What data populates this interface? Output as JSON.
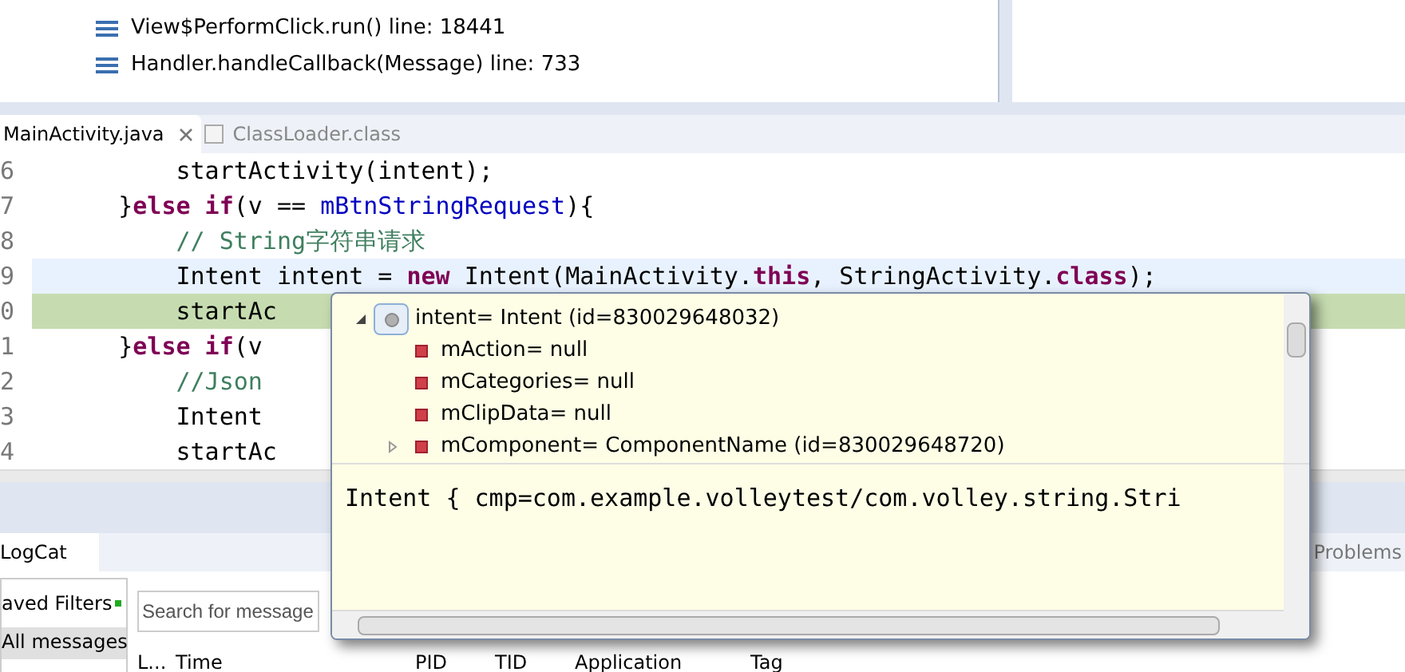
{
  "stack_frames": [
    {
      "label": "View$PerformClick.run() line: 18441"
    },
    {
      "label": "Handler.handleCallback(Message) line: 733"
    }
  ],
  "editor": {
    "tabs": [
      {
        "label": "MainActivity.java",
        "selected": true,
        "closable": true
      },
      {
        "label": "ClassLoader.class",
        "selected": false,
        "closable": false
      }
    ],
    "lines": [
      {
        "number": "6",
        "current": false,
        "suspended": false,
        "tokens": [
          {
            "kind": "plain",
            "text": "        startActivity(intent);"
          }
        ]
      },
      {
        "number": "7",
        "current": false,
        "suspended": false,
        "tokens": [
          {
            "kind": "plain",
            "text": "    }"
          },
          {
            "kind": "keyword",
            "text": "else if"
          },
          {
            "kind": "plain",
            "text": "(v == "
          },
          {
            "kind": "field",
            "text": "mBtnStringRequest"
          },
          {
            "kind": "plain",
            "text": "){"
          }
        ]
      },
      {
        "number": "8",
        "current": false,
        "suspended": false,
        "tokens": [
          {
            "kind": "comment",
            "text": "        // String字符串请求"
          }
        ]
      },
      {
        "number": "9",
        "current": true,
        "suspended": false,
        "tokens": [
          {
            "kind": "plain",
            "text": "        Intent intent = "
          },
          {
            "kind": "keyword",
            "text": "new"
          },
          {
            "kind": "plain",
            "text": " Intent(MainActivity."
          },
          {
            "kind": "keyword",
            "text": "this"
          },
          {
            "kind": "plain",
            "text": ", StringActivity."
          },
          {
            "kind": "keyword",
            "text": "class"
          },
          {
            "kind": "plain",
            "text": ");"
          }
        ]
      },
      {
        "number": "0",
        "current": false,
        "suspended": true,
        "tokens": [
          {
            "kind": "plain",
            "text": "        startAc"
          }
        ]
      },
      {
        "number": "1",
        "current": false,
        "suspended": false,
        "tokens": [
          {
            "kind": "plain",
            "text": "    }"
          },
          {
            "kind": "keyword",
            "text": "else if"
          },
          {
            "kind": "plain",
            "text": "(v"
          }
        ]
      },
      {
        "number": "2",
        "current": false,
        "suspended": false,
        "tokens": [
          {
            "kind": "comment",
            "text": "        //Json"
          }
        ]
      },
      {
        "number": "3",
        "current": false,
        "suspended": false,
        "tokens": [
          {
            "kind": "plain",
            "text": "        Intent"
          }
        ]
      },
      {
        "number": "4",
        "current": false,
        "suspended": false,
        "tokens": [
          {
            "kind": "plain",
            "text": "        startAc"
          }
        ]
      }
    ]
  },
  "inspector": {
    "tree": [
      {
        "label": "intent= Intent  (id=830029648032)",
        "kind": "local",
        "expanded": true,
        "children": [
          {
            "label": "mAction= null",
            "kind": "field"
          },
          {
            "label": "mCategories= null",
            "kind": "field"
          },
          {
            "label": "mClipData= null",
            "kind": "field"
          },
          {
            "label": "mComponent= ComponentName  (id=830029648720)",
            "kind": "field",
            "has_children": true
          }
        ]
      }
    ],
    "detail": "Intent { cmp=com.example.volleytest/com.volley.string.Stri"
  },
  "logcat": {
    "tab": "LogCat",
    "filters_title": "aved Filters",
    "filters": [
      {
        "label": "All messages",
        "selected": true
      }
    ],
    "search": {
      "placeholder": "Search for message"
    },
    "columns": [
      "L...",
      "Time",
      "PID",
      "TID",
      "Application",
      "Tag"
    ]
  },
  "problems_tab": "Problems"
}
